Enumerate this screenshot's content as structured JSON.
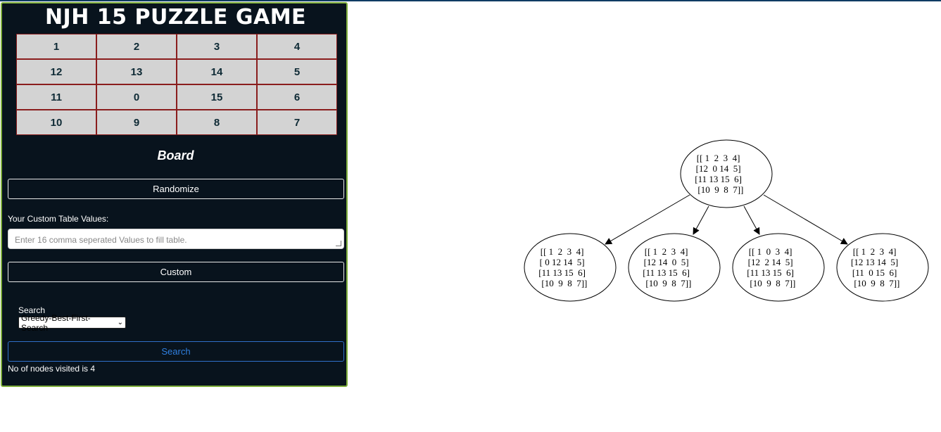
{
  "title": "NJH 15 PUZZLE GAME",
  "board": {
    "tiles": [
      [
        "1",
        "2",
        "3",
        "4"
      ],
      [
        "12",
        "13",
        "14",
        "5"
      ],
      [
        "11",
        "0",
        "15",
        "6"
      ],
      [
        "10",
        "9",
        "8",
        "7"
      ]
    ],
    "label": "Board"
  },
  "buttons": {
    "randomize": "Randomize",
    "custom": "Custom",
    "search": "Search"
  },
  "custom": {
    "label": "Your Custom Table Values:",
    "placeholder": "Enter 16 comma seperated Values to fill table."
  },
  "search": {
    "label": "Search",
    "selected_option": "Greedy-Best-First-Search"
  },
  "status": {
    "visited": "No of nodes visited is 4"
  },
  "tree": {
    "root": [
      "[[ 1  2  3  4]",
      "[12  0 14  5]",
      "[11 13 15  6]",
      "[10  9  8  7]]"
    ],
    "children": [
      [
        "[[ 1  2  3  4]",
        "[ 0 12 14  5]",
        "[11 13 15  6]",
        "[10  9  8  7]]"
      ],
      [
        "[[ 1  2  3  4]",
        "[12 14  0  5]",
        "[11 13 15  6]",
        "[10  9  8  7]]"
      ],
      [
        "[[ 1  0  3  4]",
        "[12  2 14  5]",
        "[11 13 15  6]",
        "[10  9  8  7]]"
      ],
      [
        "[[ 1  2  3  4]",
        "[12 13 14  5]",
        "[11  0 15  6]",
        "[10  9  8  7]]"
      ]
    ]
  }
}
